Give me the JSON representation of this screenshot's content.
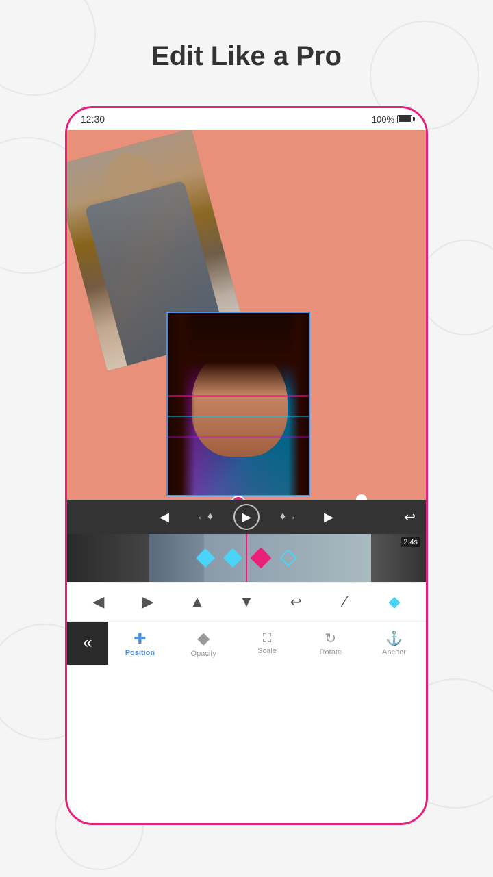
{
  "page": {
    "title": "Edit Like a Pro",
    "background_color": "#f5f5f5"
  },
  "phone": {
    "status_bar": {
      "time": "12:30",
      "battery_percent": "100%"
    },
    "canvas": {
      "background_color": "#e8907a"
    },
    "timeline": {
      "duration": "2.4s"
    },
    "bottom_toolbar": {
      "buttons": [
        "◀",
        "▶",
        "▲",
        "▼",
        "↩",
        "╱",
        "◇"
      ]
    },
    "bottom_nav": {
      "collapse_label": "«",
      "items": [
        {
          "id": "position",
          "label": "Position",
          "active": true
        },
        {
          "id": "opacity",
          "label": "Opacity",
          "active": false
        },
        {
          "id": "scale",
          "label": "Scale",
          "active": false
        },
        {
          "id": "rotate",
          "label": "Rotate",
          "active": false
        },
        {
          "id": "anchor",
          "label": "Anchor",
          "active": false
        }
      ]
    }
  }
}
